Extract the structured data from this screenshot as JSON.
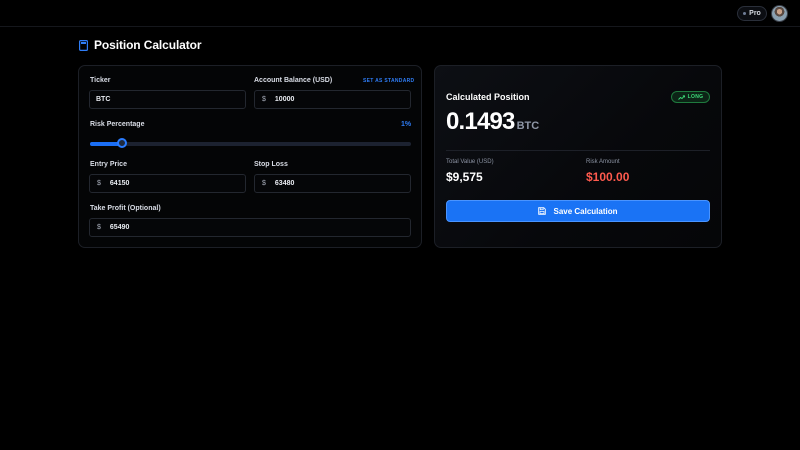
{
  "header": {
    "plan_badge": "Pro"
  },
  "page": {
    "title": "Position Calculator",
    "icon": "calculator-icon"
  },
  "form": {
    "ticker": {
      "label": "Ticker",
      "value": "BTC"
    },
    "account_balance": {
      "label": "Account Balance (USD)",
      "value": "10000",
      "prefix": "$",
      "action_label": "SET AS STANDARD"
    },
    "risk_percentage": {
      "label": "Risk Percentage",
      "value_label": "1%",
      "value": 0.1
    },
    "entry_price": {
      "label": "Entry Price",
      "value": "64150",
      "prefix": "$"
    },
    "stop_loss": {
      "label": "Stop Loss",
      "value": "63480",
      "prefix": "$"
    },
    "take_profit": {
      "label": "Take Profit (Optional)",
      "value": "65490",
      "prefix": "$"
    }
  },
  "result": {
    "title": "Calculated Position",
    "direction_badge": "LONG",
    "position_size": "0.1493",
    "position_unit": "BTC",
    "total_value_label": "Total Value (USD)",
    "total_value": "$9,575",
    "risk_amount_label": "Risk Amount",
    "risk_amount": "$100.00",
    "save_label": "Save Calculation"
  },
  "colors": {
    "accent": "#1a73f5",
    "long_green": "#3ddc7a",
    "risk_red": "#ff5a4e",
    "background": "#000000"
  }
}
